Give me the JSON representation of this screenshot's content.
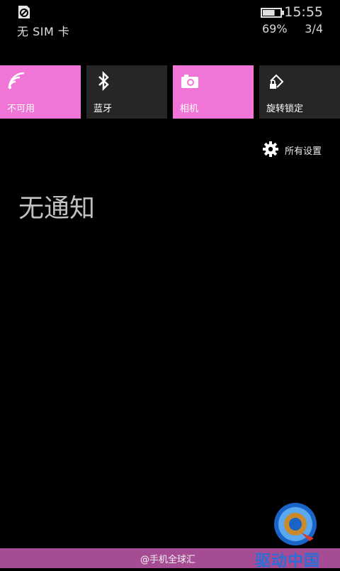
{
  "status_bar": {
    "sim_text": "无 SIM 卡",
    "time": "15:55",
    "battery_percent": "69%",
    "battery_level": 0.69,
    "page_indicator": "3/4"
  },
  "quick_actions": [
    {
      "label": "不可用",
      "icon": "wifi-icon",
      "state": "on"
    },
    {
      "label": "蓝牙",
      "icon": "bluetooth-icon",
      "state": "off"
    },
    {
      "label": "相机",
      "icon": "camera-icon",
      "state": "on"
    },
    {
      "label": "旋转锁定",
      "icon": "rotation-lock-icon",
      "state": "off"
    }
  ],
  "settings_link": {
    "label": "所有设置",
    "icon": "gear-icon"
  },
  "notifications": {
    "empty_text": "无通知"
  },
  "watermark": {
    "text": "@手机全球汇",
    "brand": "驱动中国"
  },
  "colors": {
    "accent": "#f075d6",
    "tile_off": "#262626",
    "background": "#000000",
    "footer": "#a64c94"
  }
}
